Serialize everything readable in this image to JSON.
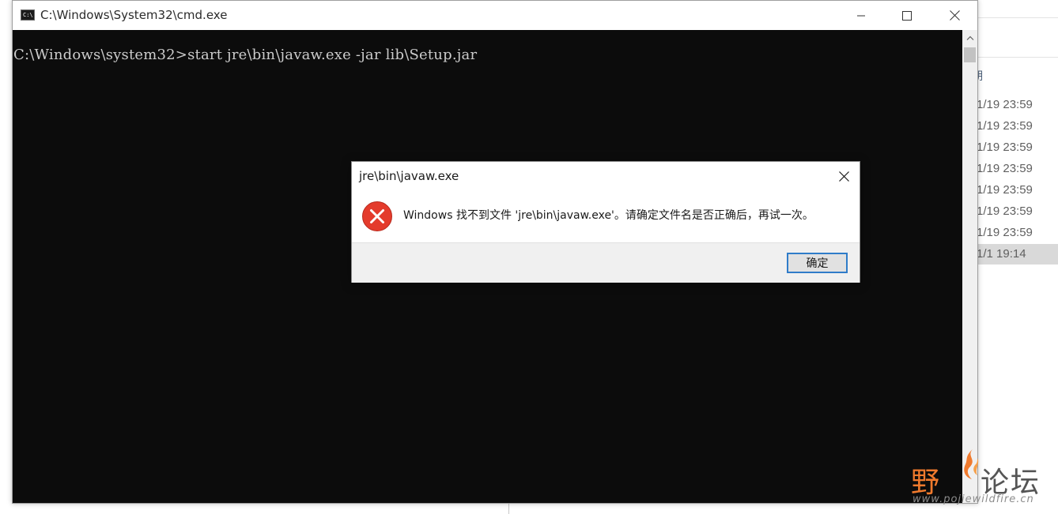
{
  "background_explorer": {
    "column_header": "期",
    "rows": [
      {
        "date": "1/19 23:59",
        "selected": false
      },
      {
        "date": "1/19 23:59",
        "selected": false
      },
      {
        "date": "1/19 23:59",
        "selected": false
      },
      {
        "date": "1/19 23:59",
        "selected": false
      },
      {
        "date": "1/19 23:59",
        "selected": false
      },
      {
        "date": "1/19 23:59",
        "selected": false
      },
      {
        "date": "1/19 23:59",
        "selected": false
      },
      {
        "date": "1/1 19:14",
        "selected": true
      }
    ]
  },
  "cmd_window": {
    "title": "C:\\Windows\\System32\\cmd.exe",
    "icon": "cmd-icon",
    "icon_text": "C:\\",
    "controls": {
      "minimize": "minimize-icon",
      "maximize": "maximize-icon",
      "close": "close-icon"
    },
    "console_lines": [
      "C:\\Windows\\system32>start jre\\bin\\javaw.exe -jar lib\\Setup.jar"
    ],
    "colors": {
      "background": "#0c0c0c",
      "text": "#cccccc"
    }
  },
  "error_dialog": {
    "title": "jre\\bin\\javaw.exe",
    "icon": "error-icon",
    "message": "Windows 找不到文件 'jre\\bin\\javaw.exe'。请确定文件名是否正确后，再试一次。",
    "ok_label": "确定",
    "colors": {
      "error_red": "#e43b2c",
      "button_border": "#2f7cc9"
    }
  },
  "watermark": {
    "brand_left": "野",
    "brand_right": "论坛",
    "url": "www.pojiewildfire.cn",
    "colors": {
      "orange": "#f07a2d",
      "gray": "#555555"
    }
  }
}
